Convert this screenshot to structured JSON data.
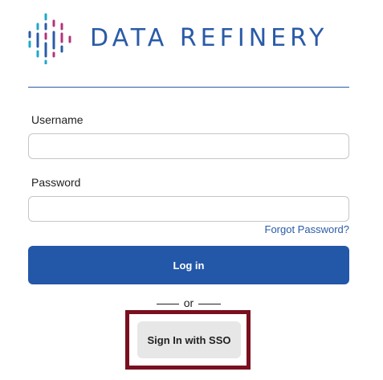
{
  "brand": {
    "name": "DATA REFINERY",
    "colors": {
      "primary": "#2a5ba7",
      "magenta": "#b0357a",
      "cyan": "#1fa8c9"
    }
  },
  "form": {
    "username_label": "Username",
    "username_value": "",
    "password_label": "Password",
    "password_value": "",
    "forgot_link": "Forgot Password?",
    "login_button": "Log in",
    "or_text": "or",
    "sso_button": "Sign In with SSO"
  },
  "highlight": {
    "color": "#7a0f1f",
    "target": "sso-button"
  }
}
